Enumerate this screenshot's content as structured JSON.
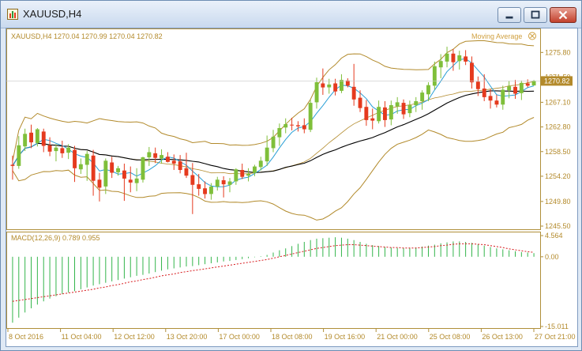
{
  "window": {
    "title": "XAUUSD,H4"
  },
  "main_chart": {
    "header": "XAUUSD,H4  1270.04 1270.99 1270.04 1270.82",
    "indicator_label": "Moving Average",
    "current_price_label": "1270.82",
    "price_ticks": [
      "1275.80",
      "1271.50",
      "1267.10",
      "1262.80",
      "1258.50",
      "1254.20",
      "1249.80",
      "1245.50"
    ]
  },
  "macd": {
    "header": "MACD(12,26,9) 0.789 0.955",
    "ticks": [
      "4.564",
      "0.00",
      "-15.011"
    ]
  },
  "time_axis": {
    "labels": [
      "8 Oct 2016",
      "11 Oct 04:00",
      "12 Oct 12:00",
      "13 Oct 20:00",
      "17 Oct 00:00",
      "18 Oct 08:00",
      "19 Oct 16:00",
      "21 Oct 00:00",
      "25 Oct 08:00",
      "26 Oct 13:00",
      "27 Oct 21:00"
    ]
  },
  "colors": {
    "bull": "#7fbf3a",
    "bear": "#e53a1e",
    "upper_lower_band": "#b28a2b",
    "fast_ma": "#2a9fd6",
    "slow_ma": "#000000",
    "macd_hist": "#33b54b",
    "macd_signal": "#d7191c",
    "axis_text": "#b38a2b"
  },
  "chart_data": {
    "type": "candlestick",
    "symbol": "XAUUSD",
    "timeframe": "H4",
    "ylim": [
      1245.5,
      1277.5
    ],
    "candles": [
      {
        "o": 1256.2,
        "h": 1257.8,
        "l": 1253.6,
        "c": 1256.0
      },
      {
        "o": 1256.0,
        "h": 1261.2,
        "l": 1255.5,
        "c": 1259.6
      },
      {
        "o": 1259.4,
        "h": 1262.5,
        "l": 1258.6,
        "c": 1261.6
      },
      {
        "o": 1261.8,
        "h": 1263.2,
        "l": 1259.1,
        "c": 1260.1
      },
      {
        "o": 1260.0,
        "h": 1262.6,
        "l": 1259.4,
        "c": 1262.4
      },
      {
        "o": 1262.0,
        "h": 1262.5,
        "l": 1258.4,
        "c": 1259.5
      },
      {
        "o": 1259.6,
        "h": 1261.0,
        "l": 1257.7,
        "c": 1258.5
      },
      {
        "o": 1258.6,
        "h": 1259.8,
        "l": 1256.8,
        "c": 1259.2
      },
      {
        "o": 1259.1,
        "h": 1260.4,
        "l": 1257.4,
        "c": 1258.2
      },
      {
        "o": 1258.3,
        "h": 1259.8,
        "l": 1257.2,
        "c": 1259.2
      },
      {
        "o": 1258.8,
        "h": 1259.5,
        "l": 1253.2,
        "c": 1255.6
      },
      {
        "o": 1255.4,
        "h": 1257.3,
        "l": 1254.6,
        "c": 1256.3
      },
      {
        "o": 1256.2,
        "h": 1258.6,
        "l": 1253.4,
        "c": 1258.1
      },
      {
        "o": 1257.8,
        "h": 1258.8,
        "l": 1250.8,
        "c": 1253.4
      },
      {
        "o": 1253.6,
        "h": 1254.8,
        "l": 1249.8,
        "c": 1252.2
      },
      {
        "o": 1252.4,
        "h": 1257.3,
        "l": 1251.1,
        "c": 1256.9
      },
      {
        "o": 1256.6,
        "h": 1257.6,
        "l": 1253.9,
        "c": 1254.8
      },
      {
        "o": 1254.9,
        "h": 1256.0,
        "l": 1254.3,
        "c": 1255.6
      },
      {
        "o": 1255.2,
        "h": 1256.4,
        "l": 1249.9,
        "c": 1253.8
      },
      {
        "o": 1253.6,
        "h": 1255.9,
        "l": 1251.4,
        "c": 1253.1
      },
      {
        "o": 1253.0,
        "h": 1255.6,
        "l": 1251.6,
        "c": 1253.8
      },
      {
        "o": 1253.6,
        "h": 1257.6,
        "l": 1253.1,
        "c": 1257.5
      },
      {
        "o": 1257.5,
        "h": 1259.3,
        "l": 1256.0,
        "c": 1258.4
      },
      {
        "o": 1258.2,
        "h": 1259.2,
        "l": 1256.5,
        "c": 1257.4
      },
      {
        "o": 1257.3,
        "h": 1258.9,
        "l": 1256.4,
        "c": 1257.9
      },
      {
        "o": 1257.6,
        "h": 1258.4,
        "l": 1256.6,
        "c": 1256.7
      },
      {
        "o": 1256.9,
        "h": 1258.0,
        "l": 1255.3,
        "c": 1256.4
      },
      {
        "o": 1256.8,
        "h": 1257.9,
        "l": 1254.7,
        "c": 1255.3
      },
      {
        "o": 1255.6,
        "h": 1258.3,
        "l": 1253.9,
        "c": 1254.3
      },
      {
        "o": 1254.4,
        "h": 1256.5,
        "l": 1247.6,
        "c": 1252.7
      },
      {
        "o": 1252.8,
        "h": 1254.6,
        "l": 1250.8,
        "c": 1252.0
      },
      {
        "o": 1252.1,
        "h": 1253.3,
        "l": 1250.3,
        "c": 1251.1
      },
      {
        "o": 1251.1,
        "h": 1253.0,
        "l": 1250.1,
        "c": 1252.4
      },
      {
        "o": 1252.4,
        "h": 1254.1,
        "l": 1251.7,
        "c": 1253.6
      },
      {
        "o": 1253.5,
        "h": 1254.2,
        "l": 1250.5,
        "c": 1252.8
      },
      {
        "o": 1252.7,
        "h": 1253.9,
        "l": 1251.4,
        "c": 1253.3
      },
      {
        "o": 1253.3,
        "h": 1255.6,
        "l": 1252.7,
        "c": 1255.4
      },
      {
        "o": 1255.3,
        "h": 1256.4,
        "l": 1253.7,
        "c": 1254.1
      },
      {
        "o": 1254.3,
        "h": 1255.6,
        "l": 1253.3,
        "c": 1254.6
      },
      {
        "o": 1254.8,
        "h": 1256.2,
        "l": 1254.2,
        "c": 1255.9
      },
      {
        "o": 1255.8,
        "h": 1257.6,
        "l": 1255.2,
        "c": 1256.9
      },
      {
        "o": 1256.8,
        "h": 1261.3,
        "l": 1256.0,
        "c": 1259.2
      },
      {
        "o": 1259.1,
        "h": 1262.3,
        "l": 1258.4,
        "c": 1261.1
      },
      {
        "o": 1261.0,
        "h": 1263.4,
        "l": 1259.5,
        "c": 1262.6
      },
      {
        "o": 1262.7,
        "h": 1264.3,
        "l": 1261.7,
        "c": 1263.3
      },
      {
        "o": 1263.2,
        "h": 1264.4,
        "l": 1262.2,
        "c": 1263.1
      },
      {
        "o": 1263.1,
        "h": 1263.8,
        "l": 1262.0,
        "c": 1262.9
      },
      {
        "o": 1263.1,
        "h": 1264.3,
        "l": 1261.7,
        "c": 1262.4
      },
      {
        "o": 1262.3,
        "h": 1267.5,
        "l": 1261.9,
        "c": 1267.0
      },
      {
        "o": 1267.1,
        "h": 1271.4,
        "l": 1266.0,
        "c": 1270.6
      },
      {
        "o": 1270.4,
        "h": 1273.0,
        "l": 1268.4,
        "c": 1269.7
      },
      {
        "o": 1269.7,
        "h": 1271.2,
        "l": 1268.6,
        "c": 1270.2
      },
      {
        "o": 1270.4,
        "h": 1271.2,
        "l": 1268.3,
        "c": 1269.0
      },
      {
        "o": 1269.1,
        "h": 1272.0,
        "l": 1268.7,
        "c": 1271.0
      },
      {
        "o": 1270.9,
        "h": 1271.3,
        "l": 1269.7,
        "c": 1270.0
      },
      {
        "o": 1269.8,
        "h": 1273.8,
        "l": 1266.5,
        "c": 1267.6
      },
      {
        "o": 1267.9,
        "h": 1269.2,
        "l": 1265.4,
        "c": 1266.1
      },
      {
        "o": 1266.3,
        "h": 1267.5,
        "l": 1263.0,
        "c": 1264.0
      },
      {
        "o": 1264.3,
        "h": 1266.0,
        "l": 1262.4,
        "c": 1263.9
      },
      {
        "o": 1263.8,
        "h": 1267.4,
        "l": 1263.4,
        "c": 1266.3
      },
      {
        "o": 1266.2,
        "h": 1267.3,
        "l": 1262.8,
        "c": 1264.0
      },
      {
        "o": 1264.1,
        "h": 1267.4,
        "l": 1263.1,
        "c": 1266.6
      },
      {
        "o": 1266.4,
        "h": 1268.0,
        "l": 1265.1,
        "c": 1267.1
      },
      {
        "o": 1267.0,
        "h": 1267.6,
        "l": 1264.2,
        "c": 1265.0
      },
      {
        "o": 1265.2,
        "h": 1267.4,
        "l": 1264.5,
        "c": 1266.6
      },
      {
        "o": 1266.6,
        "h": 1268.0,
        "l": 1265.4,
        "c": 1267.3
      },
      {
        "o": 1267.3,
        "h": 1269.2,
        "l": 1265.8,
        "c": 1268.8
      },
      {
        "o": 1268.5,
        "h": 1270.6,
        "l": 1267.3,
        "c": 1270.1
      },
      {
        "o": 1270.0,
        "h": 1274.2,
        "l": 1269.3,
        "c": 1273.4
      },
      {
        "o": 1273.2,
        "h": 1275.5,
        "l": 1271.3,
        "c": 1274.3
      },
      {
        "o": 1274.2,
        "h": 1276.8,
        "l": 1273.2,
        "c": 1275.6
      },
      {
        "o": 1275.6,
        "h": 1276.4,
        "l": 1272.6,
        "c": 1274.1
      },
      {
        "o": 1274.3,
        "h": 1276.1,
        "l": 1272.8,
        "c": 1275.3
      },
      {
        "o": 1275.1,
        "h": 1276.2,
        "l": 1273.6,
        "c": 1274.2
      },
      {
        "o": 1274.0,
        "h": 1275.1,
        "l": 1269.5,
        "c": 1270.6
      },
      {
        "o": 1270.7,
        "h": 1271.6,
        "l": 1268.2,
        "c": 1269.4
      },
      {
        "o": 1269.5,
        "h": 1272.0,
        "l": 1267.3,
        "c": 1268.0
      },
      {
        "o": 1268.2,
        "h": 1269.4,
        "l": 1266.0,
        "c": 1267.4
      },
      {
        "o": 1267.4,
        "h": 1268.4,
        "l": 1266.2,
        "c": 1266.7
      },
      {
        "o": 1266.7,
        "h": 1270.0,
        "l": 1265.8,
        "c": 1269.3
      },
      {
        "o": 1269.2,
        "h": 1270.8,
        "l": 1267.8,
        "c": 1269.9
      },
      {
        "o": 1269.8,
        "h": 1271.0,
        "l": 1267.7,
        "c": 1268.6
      },
      {
        "o": 1268.7,
        "h": 1270.9,
        "l": 1267.5,
        "c": 1270.5
      },
      {
        "o": 1270.4,
        "h": 1271.1,
        "l": 1269.7,
        "c": 1270.0
      },
      {
        "o": 1270.04,
        "h": 1270.99,
        "l": 1270.04,
        "c": 1270.82
      }
    ],
    "macd": {
      "ylim": [
        -15.011,
        4.564
      ],
      "histogram": [
        -14.2,
        -13.1,
        -12.0,
        -11.1,
        -10.3,
        -9.6,
        -9.0,
        -8.5,
        -8.0,
        -7.7,
        -7.4,
        -7.0,
        -6.6,
        -6.2,
        -5.9,
        -5.6,
        -5.3,
        -5.0,
        -4.7,
        -4.4,
        -4.1,
        -3.9,
        -3.6,
        -3.3,
        -3.0,
        -2.7,
        -2.5,
        -2.3,
        -2.1,
        -2.0,
        -1.8,
        -1.6,
        -1.4,
        -1.2,
        -1.0,
        -0.9,
        -0.7,
        -0.5,
        -0.3,
        -0.1,
        0.1,
        0.4,
        0.9,
        1.4,
        1.8,
        2.3,
        2.8,
        3.2,
        3.6,
        3.9,
        4.0,
        4.1,
        4.2,
        4.1,
        3.9,
        3.6,
        3.2,
        2.8,
        2.5,
        2.3,
        2.1,
        2.0,
        1.9,
        1.9,
        1.9,
        2.0,
        2.2,
        2.4,
        2.6,
        2.9,
        3.1,
        3.3,
        3.3,
        3.2,
        3.0,
        2.7,
        2.4,
        2.1,
        1.8,
        1.6,
        1.4,
        1.2,
        1.0,
        0.9,
        0.79
      ],
      "signal": [
        -9.6,
        -9.4,
        -9.2,
        -9.0,
        -8.8,
        -8.6,
        -8.4,
        -8.2,
        -8.0,
        -7.8,
        -7.6,
        -7.4,
        -7.2,
        -7.0,
        -6.7,
        -6.5,
        -6.2,
        -6.0,
        -5.7,
        -5.4,
        -5.2,
        -4.9,
        -4.7,
        -4.4,
        -4.1,
        -3.9,
        -3.7,
        -3.4,
        -3.2,
        -3.0,
        -2.8,
        -2.6,
        -2.4,
        -2.2,
        -2.0,
        -1.8,
        -1.6,
        -1.4,
        -1.2,
        -1.0,
        -0.8,
        -0.6,
        -0.3,
        0.0,
        0.3,
        0.6,
        0.9,
        1.2,
        1.5,
        1.8,
        2.0,
        2.2,
        2.4,
        2.5,
        2.6,
        2.6,
        2.5,
        2.4,
        2.3,
        2.2,
        2.1,
        2.0,
        2.0,
        1.9,
        1.9,
        1.9,
        2.0,
        2.1,
        2.2,
        2.4,
        2.5,
        2.7,
        2.8,
        2.8,
        2.8,
        2.7,
        2.6,
        2.4,
        2.2,
        2.0,
        1.7,
        1.5,
        1.3,
        1.1,
        0.955
      ]
    }
  }
}
